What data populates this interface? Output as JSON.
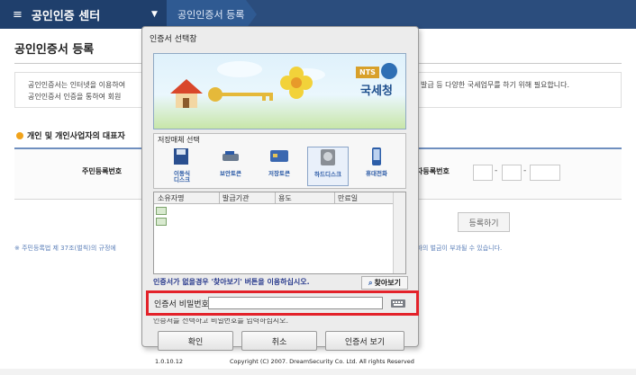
{
  "header": {
    "menu_label": "공인인증 센터",
    "breadcrumb": "공인인증서 등록"
  },
  "page": {
    "title": "공인인증서 등록",
    "notice_line1": "공인인증서는 인터넷을 이용하여",
    "notice_line1_right": "발급 등 다양한 국세업무를 하기 위해 필요합니다.",
    "notice_line2": "공인인증서 인증을 통하여 회원",
    "section_head": "개인 및 개인사업자의 대표자",
    "field_left": "주민등록번호",
    "field_right": "자등록번호",
    "register_button": "등록하기",
    "footnote_left": "※ 주민등록법 제 37조(벌칙)의 규정에",
    "footnote_right": "이하의 벌금이 부과될 수 있습니다."
  },
  "dialog": {
    "title": "인증서 선택창",
    "banner": {
      "brand": "NTS",
      "org": "국세청"
    },
    "storage_label": "저장매체 선택",
    "media": [
      {
        "label": "이동식\n디스크",
        "icon": "removable-disk-icon",
        "selected": false
      },
      {
        "label": "보안토큰",
        "icon": "security-token-icon",
        "selected": false
      },
      {
        "label": "저장토큰",
        "icon": "smart-card-icon",
        "selected": false
      },
      {
        "label": "하드디스크",
        "icon": "hard-disk-icon",
        "selected": true
      },
      {
        "label": "휴대전화",
        "icon": "mobile-phone-icon",
        "selected": false
      }
    ],
    "columns": [
      "소유자명",
      "발급기관",
      "용도",
      "만료일"
    ],
    "hint": "인증서가 없을경우 '찾아보기' 버튼을 이용하십시오.",
    "find_button": "찾아보기",
    "pw_label": "인증서 비밀번호",
    "pw_value": "",
    "under_hint": "인증서를 선택하고 비밀번호를 입력하십시오.",
    "ok_button": "확인",
    "cancel_button": "취소",
    "view_button": "인증서 보기",
    "version": "1.0.10.12",
    "copyright": "Copyright (C) 2007. DreamSecurity Co. Ltd. All rights Reserved"
  },
  "colors": {
    "topbar": "#2b4d7d",
    "highlight": "#e3222a",
    "hint_text": "#2b3c8e"
  }
}
